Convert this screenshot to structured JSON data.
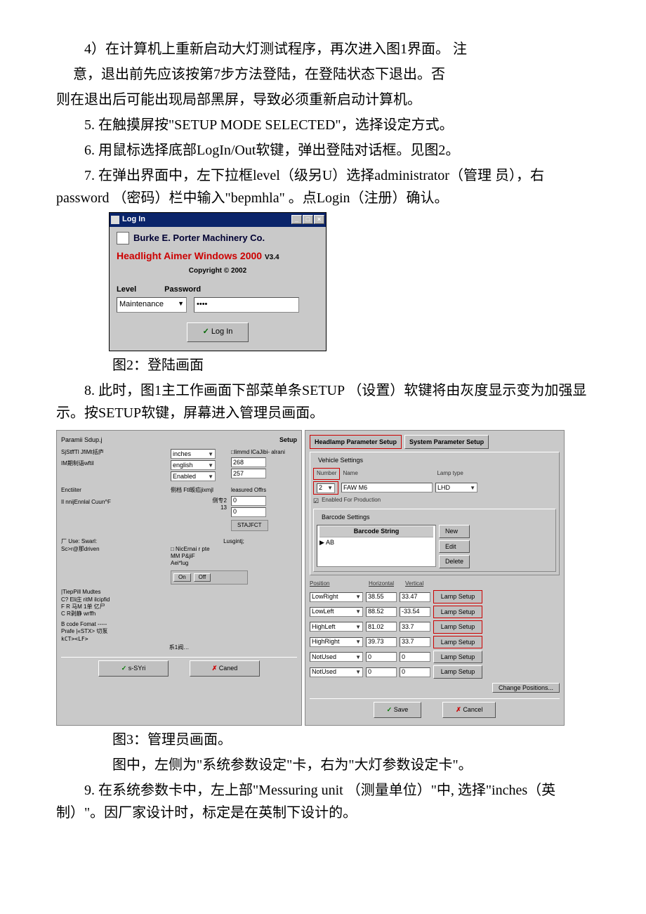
{
  "paras": {
    "p1a": "4）在计算机上重新启动大灯测试程序，再次进入图1界面。   注",
    "p1b": "意，退出前先应该按第7步方法登陆，在登陆状态下退出。否",
    "p1c": "则在退出后可能出现局部黑屏，导致必须重新启动计算机。",
    "p2": "5.   在触摸屏按\"SETUP MODE SELECTED\"，选择设定方式。",
    "p3": "6.   用鼠标选择底部LogIn/Out软键，弹出登陆对话框。见图2。",
    "p4": "7.   在弹出界面中，左下拉框level（级另U）选择administrator（管理  员），右password （密码）栏中输入\"bepmhla\" 。点Login（注册）确认。",
    "cap2": "图2：登陆画面",
    "p5": "8. 此时，图1主工作画面下部菜单条SETUP （设置）软键将由灰度显示变为加强显示。按SETUP软键，屏幕进入管理员画面。",
    "cap3": "图3：管理员画面。",
    "p6": "图中，左侧为\"系统参数设定\"卡，右为\"大灯参数设定卡\"。",
    "p7": "9. 在系统参数卡中，左上部\"Messuring unit （测量单位）\"中, 选择\"inches（英制）\"。因厂家设计时，标定是在英制下设计的。"
  },
  "login": {
    "title": "Log In",
    "min": "_",
    "max": "□",
    "close": "×",
    "brand": "Burke E. Porter Machinery Co.",
    "prod": "Headlight Aimer Windows 2000",
    "ver": "V3.4",
    "copy": "Copyright © 2002",
    "level_label": "Level",
    "pass_label": "Password",
    "level_value": "Maintenance",
    "pass_value": "••••",
    "login_btn": "Log In"
  },
  "admin_left": {
    "title": "Paramii Sdup.j",
    "setup": "Setup",
    "l1": "SjStffTl JfiMt括庐",
    "l2": "IM期制语wftil",
    "opt_inches": "inches",
    "opt_english": "english",
    "opt_enabled": "Enabled",
    "enctiiter": "Enctiiter",
    "ftl": "侧档 Ftl皈疝jixmjl",
    "il": "Il nnijEnnlal Cuun^F",
    "side2": "侧专2",
    "v13": "13",
    "limmd": "□limmd lCaJibi- alrani",
    "n268": "268",
    "n257": "257",
    "meas": "leasured Offrs",
    "z1": "0",
    "z2": "0",
    "stajfct": "STAJFCT",
    "use_swarl": "厂 Use:   Swarl:",
    "scr": "Sc>r@那driven",
    "lusg": "Lusgintj;",
    "nic": "□ NicErnai r pte",
    "mm": "MM   P&jiF",
    "aei": "Aei*lug",
    "on": "On",
    "off": "Off",
    "tiep": "|TiepPill Mudtes",
    "c7": "C?  Eli庄  ritM ilcipfid",
    "fr": "F R 马M             1单 亿尸",
    "cr": "C R剥静  wrffh",
    "code": "B  code Fomat -----",
    "prafe": "Prafe |«STX> 切泵",
    "kct": "kCT><LF>",
    "s1": "系1阀…",
    "ssys": "s-SYri",
    "cancel": "Caned"
  },
  "admin_right": {
    "tab1": "Headlamp Parameter Setup",
    "tab2": "System Parameter Setup",
    "veh": "Vehicle Settings",
    "number": "Number",
    "name": "Name",
    "lamptype": "Lamp type",
    "num_v": "2",
    "name_v": "FAW M6",
    "lamp_v": "LHD",
    "enabled_chk": "Enabled For Production",
    "barcode": "Barcode Settings",
    "bcstr": "Barcode String",
    "bcrow": "AB",
    "new": "New",
    "edit": "Edit",
    "delete": "Delete",
    "pos": "Position",
    "horiz": "Horizontal",
    "vert": "Vertical",
    "rows": [
      {
        "pos": "LowRight",
        "h": "38.55",
        "v": "33.47",
        "btn": "Lamp Setup",
        "red": true
      },
      {
        "pos": "LowLeft",
        "h": "88.52",
        "v": "-33.54",
        "btn": "Lamp Setup",
        "red": true
      },
      {
        "pos": "HighLeft",
        "h": "81.02",
        "v": "33.7",
        "btn": "Lamp Setup",
        "red": true
      },
      {
        "pos": "HighRight",
        "h": "39.73",
        "v": "33.7",
        "btn": "Lamp Setup",
        "red": true
      },
      {
        "pos": "NotUsed",
        "h": "0",
        "v": "0",
        "btn": "Lamp Setup",
        "red": false
      },
      {
        "pos": "NotUsed",
        "h": "0",
        "v": "0",
        "btn": "Lamp Setup",
        "red": false
      }
    ],
    "change": "Change Positions...",
    "save": "Save",
    "cancel": "Cancel"
  }
}
